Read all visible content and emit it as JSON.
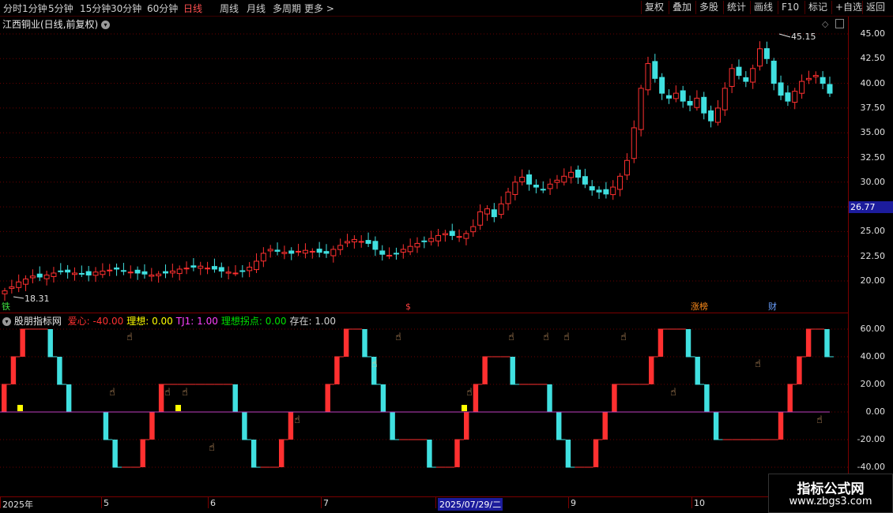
{
  "toolbar": {
    "periods": [
      "分时",
      "1分钟",
      "5分钟",
      "15分钟",
      "30分钟",
      "60分钟",
      "日线",
      "周线",
      "月线",
      "多周期",
      "更多 >"
    ],
    "active_period": "日线",
    "tools": [
      "复权",
      "叠加",
      "多股",
      "统计",
      "画线",
      "F10",
      "标记",
      "+自选",
      "返回"
    ]
  },
  "price_panel": {
    "title": "江西铜业(日线,前复权)",
    "y_ticks": [
      "45.00",
      "42.50",
      "40.00",
      "37.50",
      "35.00",
      "32.50",
      "30.00",
      "27.50",
      "25.00",
      "22.50",
      "20.00"
    ],
    "current_price_label": "26.77",
    "high_label": "45.15",
    "low_label": "18.31",
    "flags": [
      "铁",
      "$",
      "涨榜",
      "财"
    ]
  },
  "indicator_panel": {
    "name": "股朋指标网",
    "params": [
      {
        "label": "爱心",
        "value": "-40.00",
        "color": "#ff3030"
      },
      {
        "label": "理想",
        "value": "0.00",
        "color": "#ffff00"
      },
      {
        "label": "TJ1",
        "value": "1.00",
        "color": "#ff40ff"
      },
      {
        "label": "理想拐点",
        "value": "0.00",
        "color": "#00e000"
      },
      {
        "label": "存在",
        "value": "1.00",
        "color": "#d0d0d0"
      }
    ],
    "y_ticks": [
      "60.00",
      "40.00",
      "20.00",
      "0.00",
      "-20.00",
      "-40.00"
    ]
  },
  "x_axis": {
    "labels": [
      "2025年",
      "5",
      "6",
      "7",
      "2025/07/29/二",
      "9",
      "10"
    ]
  },
  "watermark": {
    "title": "指标公式网",
    "url": "www.zbgs3.com"
  },
  "colors": {
    "up": "#ff3030",
    "down": "#40e0e0",
    "grid": "#7a0000",
    "ma": "#c040c0"
  },
  "chart_data": {
    "type": "candlestick",
    "ylim": [
      18,
      46
    ],
    "close_series": [
      19.0,
      19.4,
      19.9,
      20.2,
      20.5,
      20.4,
      20.6,
      20.8,
      21.0,
      20.9,
      20.8,
      20.7,
      20.6,
      20.9,
      21.0,
      21.1,
      21.2,
      21.0,
      20.9,
      20.8,
      20.7,
      20.6,
      20.7,
      20.8,
      21.0,
      21.2,
      21.3,
      21.4,
      21.5,
      21.3,
      21.2,
      21.0,
      20.9,
      20.8,
      21.0,
      21.4,
      22.0,
      22.8,
      23.2,
      23.0,
      22.9,
      22.8,
      23.0,
      23.1,
      23.0,
      22.9,
      22.8,
      23.2,
      23.6,
      24.0,
      24.2,
      24.0,
      23.8,
      23.2,
      22.7,
      22.6,
      22.8,
      23.2,
      23.5,
      23.8,
      24.0,
      24.3,
      24.6,
      24.8,
      24.6,
      24.5,
      24.8,
      25.5,
      27.0,
      27.3,
      26.5,
      27.8,
      29.0,
      30.0,
      30.5,
      29.8,
      29.5,
      29.2,
      29.8,
      30.2,
      30.6,
      31.0,
      30.5,
      29.8,
      29.2,
      29.0,
      28.8,
      29.5,
      30.6,
      32.2,
      35.5,
      39.5,
      42.0,
      40.5,
      39.0,
      38.5,
      39.0,
      38.2,
      37.8,
      38.5,
      37.0,
      36.2,
      37.5,
      39.5,
      41.5,
      40.8,
      40.2,
      41.5,
      43.5,
      42.5,
      40.0,
      38.8,
      38.2,
      39.2,
      40.2,
      40.5,
      40.8,
      40.0,
      39.0
    ]
  }
}
